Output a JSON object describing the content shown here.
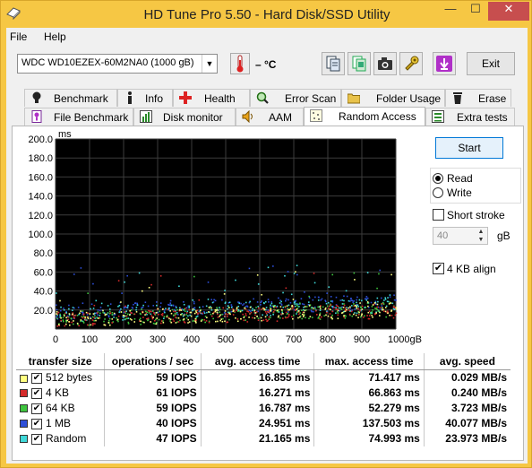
{
  "window": {
    "title": "HD Tune Pro 5.50 - Hard Disk/SSD Utility",
    "minimize_glyph": "—",
    "maximize_glyph": "☐",
    "close_glyph": "✕"
  },
  "menu": {
    "file": "File",
    "help": "Help"
  },
  "toolbar": {
    "drive": "WDC WD10EZEX-60M2NA0 (1000 gB)",
    "temperature": "– °C",
    "exit": "Exit",
    "icons": [
      "copy-info-icon",
      "copy-screenshot-icon",
      "camera-icon",
      "options-icon",
      "save-icon"
    ]
  },
  "tabs_top": [
    "Benchmark",
    "Info",
    "Health",
    "Error Scan",
    "Folder Usage",
    "Erase"
  ],
  "tabs_bottom": [
    "File Benchmark",
    "Disk monitor",
    "AAM",
    "Random Access",
    "Extra tests"
  ],
  "active_tab": "Random Access",
  "controls": {
    "start": "Start",
    "read": "Read",
    "write": "Write",
    "mode_selected": "Read",
    "short_stroke": "Short stroke",
    "short_stroke_checked": false,
    "stroke_value": "40",
    "stroke_unit": "gB",
    "align": "4 KB align",
    "align_checked": true
  },
  "chart_data": {
    "type": "scatter",
    "ylabel": "ms",
    "ylim": [
      0,
      200
    ],
    "xlim": [
      0,
      1000
    ],
    "y_ticks": [
      "200.0",
      "180.0",
      "160.0",
      "140.0",
      "120.0",
      "100.0",
      "80.0",
      "60.0",
      "40.0",
      "20.0"
    ],
    "x_ticks": [
      "0",
      "100",
      "200",
      "300",
      "400",
      "500",
      "600",
      "700",
      "800",
      "900",
      "1000gB"
    ],
    "background": "#000000",
    "grid": true,
    "series": [
      {
        "name": "512 bytes",
        "color": "#ffff80",
        "trend": [
          [
            0,
            12
          ],
          [
            1000,
            22
          ]
        ]
      },
      {
        "name": "4 KB",
        "color": "#d42a2a",
        "trend": [
          [
            0,
            12
          ],
          [
            1000,
            21
          ]
        ]
      },
      {
        "name": "64 KB",
        "color": "#3ec43e",
        "trend": [
          [
            0,
            12
          ],
          [
            1000,
            22
          ]
        ]
      },
      {
        "name": "1 MB",
        "color": "#2d4fd8",
        "trend": [
          [
            0,
            20
          ],
          [
            1000,
            30
          ]
        ]
      },
      {
        "name": "Random",
        "color": "#3fd8d8",
        "trend": [
          [
            0,
            17
          ],
          [
            1000,
            27
          ]
        ]
      }
    ]
  },
  "results": {
    "headers": [
      "transfer size",
      "operations / sec",
      "avg. access time",
      "max. access time",
      "avg. speed"
    ],
    "rows": [
      {
        "size": "512 bytes",
        "color": "#ffff80",
        "ops": "59 IOPS",
        "avg": "16.855 ms",
        "max": "71.417 ms",
        "speed": "0.029 MB/s"
      },
      {
        "size": "4 KB",
        "color": "#d42a2a",
        "ops": "61 IOPS",
        "avg": "16.271 ms",
        "max": "66.863 ms",
        "speed": "0.240 MB/s"
      },
      {
        "size": "64 KB",
        "color": "#3ec43e",
        "ops": "59 IOPS",
        "avg": "16.787 ms",
        "max": "52.279 ms",
        "speed": "3.723 MB/s"
      },
      {
        "size": "1 MB",
        "color": "#2d4fd8",
        "ops": "40 IOPS",
        "avg": "24.951 ms",
        "max": "137.503 ms",
        "speed": "40.077 MB/s"
      },
      {
        "size": "Random",
        "color": "#3fd8d8",
        "ops": "47 IOPS",
        "avg": "21.165 ms",
        "max": "74.993 ms",
        "speed": "23.973 MB/s"
      }
    ]
  }
}
